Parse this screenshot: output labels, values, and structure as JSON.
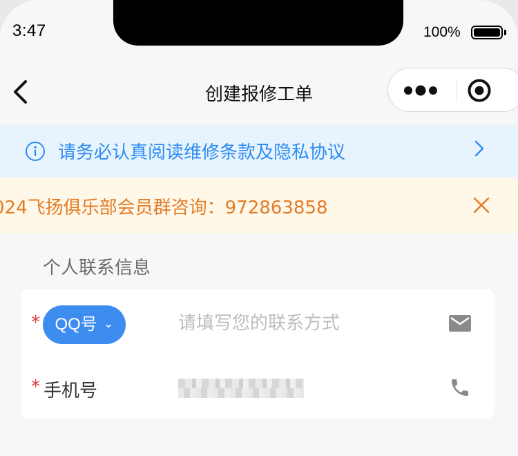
{
  "status_bar": {
    "time": "3:47",
    "battery": "100%"
  },
  "nav": {
    "title": "创建报修工单"
  },
  "notice": {
    "text": "请务必认真阅读维修条款及隐私协议"
  },
  "promo": {
    "text": "024飞扬俱乐部会员群咨询：972863858"
  },
  "form": {
    "section_title": "个人联系信息",
    "required_mark": "*",
    "contact_type": {
      "selected": "QQ号",
      "dropdown_glyph": "⌄"
    },
    "contact_placeholder": "请填写您的联系方式",
    "phone_label": "手机号"
  },
  "colors": {
    "accent": "#3d8cef",
    "notice_text": "#2f8df2",
    "notice_bg": "#e8f4fd",
    "promo_text": "#e27c28",
    "promo_bg": "#fff8e8",
    "required": "#e23b3b"
  },
  "icons": [
    "back-arrow-icon",
    "more-dots-icon",
    "close-target-icon",
    "info-icon",
    "chevron-right-icon",
    "close-icon",
    "mail-icon",
    "phone-icon"
  ]
}
